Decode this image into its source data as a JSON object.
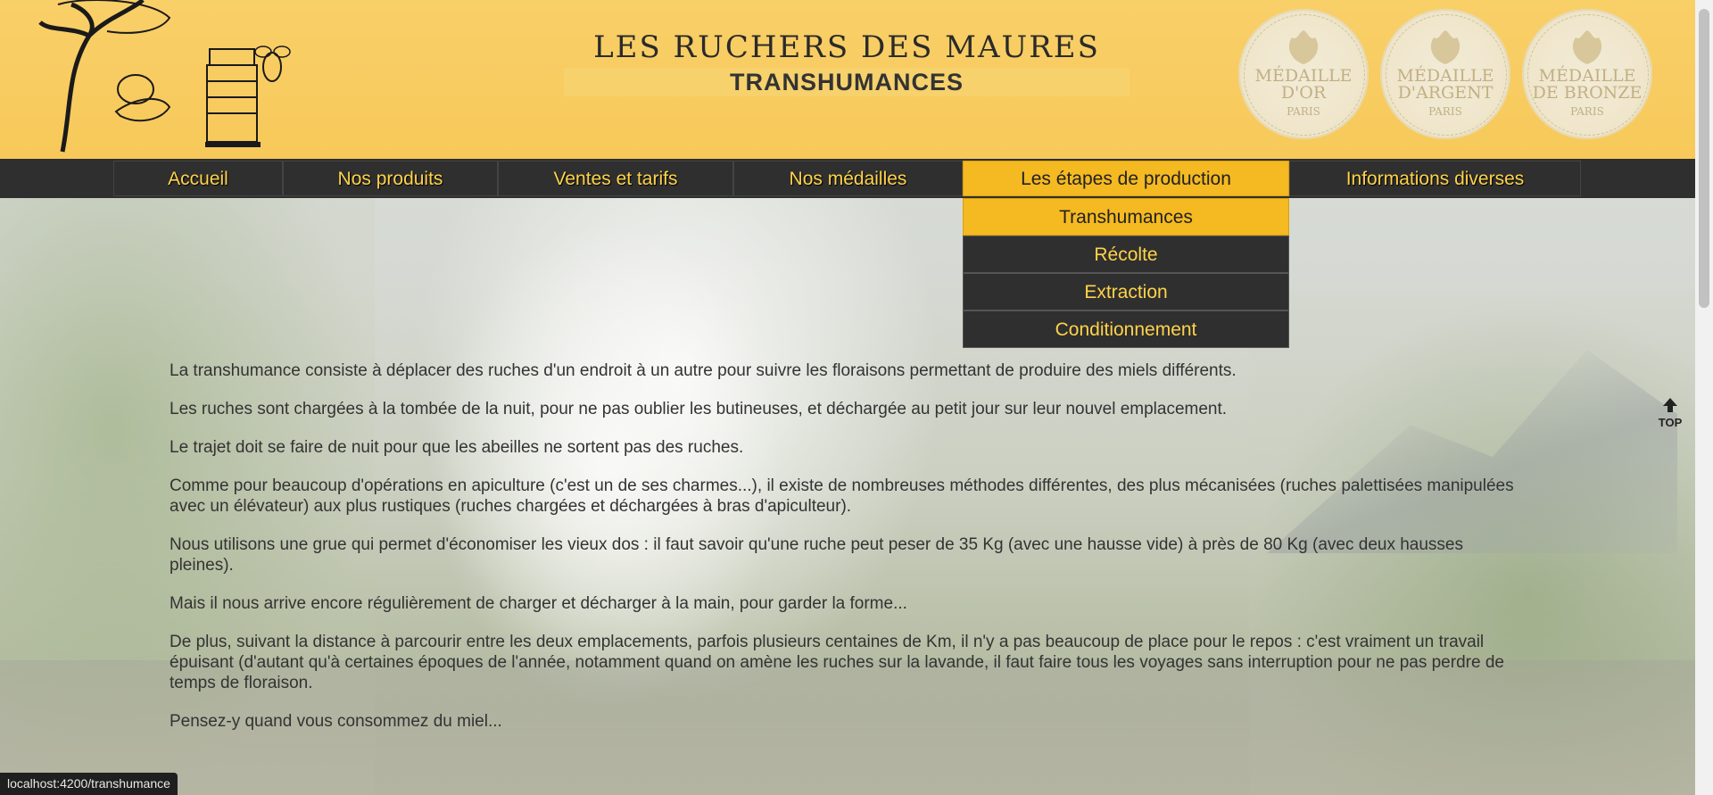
{
  "header": {
    "title": "LES RUCHERS DES MAURES",
    "subtitle": "TRANSHUMANCES",
    "medals": [
      {
        "name_line1": "MÉDAILLE",
        "name_line2": "D'OR",
        "city": "PARIS"
      },
      {
        "name_line1": "MÉDAILLE",
        "name_line2": "D'ARGENT",
        "city": "PARIS"
      },
      {
        "name_line1": "MÉDAILLE",
        "name_line2": "DE BRONZE",
        "city": "PARIS"
      }
    ]
  },
  "nav": {
    "items": [
      {
        "label": "Accueil"
      },
      {
        "label": "Nos produits"
      },
      {
        "label": "Ventes et tarifs"
      },
      {
        "label": "Nos médailles"
      },
      {
        "label": "Les étapes de production"
      },
      {
        "label": "Informations diverses"
      }
    ],
    "dropdown": [
      {
        "label": "Transhumances"
      },
      {
        "label": "Récolte"
      },
      {
        "label": "Extraction"
      },
      {
        "label": "Conditionnement"
      }
    ]
  },
  "content": {
    "paragraphs": [
      "La transhumance consiste à déplacer des ruches d'un endroit à un autre pour suivre les floraisons permettant de produire des miels différents.",
      "Les ruches sont chargées à la tombée de la nuit, pour ne pas oublier les butineuses, et déchargée au petit jour sur leur nouvel emplacement.",
      "Le trajet doit se faire de nuit pour que les abeilles ne sortent pas des ruches.",
      "Comme pour beaucoup d'opérations en apiculture (c'est un de ses charmes...), il existe de nombreuses méthodes différentes, des plus mécanisées (ruches palettisées manipulées avec un élévateur) aux plus rustiques (ruches chargées et déchargées à bras d'apiculteur).",
      "Nous utilisons une grue qui permet d'économiser les vieux dos : il faut savoir qu'une ruche peut peser de 35 Kg (avec une hausse vide) à près de 80 Kg (avec deux hausses pleines).",
      "Mais il nous arrive encore régulièrement de charger et décharger à la main, pour garder la forme...",
      "De plus, suivant la distance à parcourir entre les deux emplacements, parfois plusieurs centaines de Km, il n'y a pas beaucoup de place pour le repos : c'est vraiment un travail épuisant (d'autant qu'à certaines époques de l'année, notamment quand on amène les ruches sur la lavande, il faut faire tous les voyages sans interruption pour ne pas perdre de temps de floraison.",
      "Pensez-y quand vous consommez du miel..."
    ]
  },
  "top_button": {
    "label": "TOP",
    "icon": "arrow-up-icon"
  },
  "status_bar": {
    "url": "localhost:4200/transhumance"
  },
  "colors": {
    "header": "#f7c95a",
    "nav": "#2f2f2f",
    "nav_text": "#ffd34a",
    "active": "#f5b921"
  }
}
